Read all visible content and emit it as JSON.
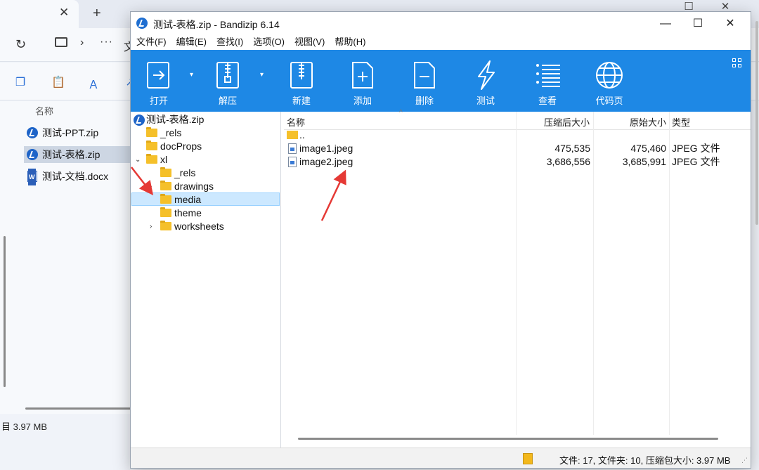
{
  "explorer": {
    "tab_close": "✕",
    "new_tab": "+",
    "more": "···",
    "partial_text": "文",
    "column_name": "名称",
    "files": [
      {
        "name": "测试-PPT.zip",
        "type": "zip"
      },
      {
        "name": "测试-表格.zip",
        "type": "zip",
        "selected": true
      },
      {
        "name": "测试-文档.docx",
        "type": "docx"
      }
    ],
    "status": "目 3.97 MB"
  },
  "bandizip": {
    "title": "测试-表格.zip - Bandizip 6.14",
    "menu": [
      "文件(F)",
      "编辑(E)",
      "查找(I)",
      "选项(O)",
      "视图(V)",
      "帮助(H)"
    ],
    "toolbar": [
      {
        "label": "打开",
        "icon": "open-icon"
      },
      {
        "label": "解压",
        "icon": "extract-icon"
      },
      {
        "label": "新建",
        "icon": "new-archive-icon"
      },
      {
        "label": "添加",
        "icon": "add-file-icon"
      },
      {
        "label": "删除",
        "icon": "delete-file-icon"
      },
      {
        "label": "测试",
        "icon": "test-lightning-icon"
      },
      {
        "label": "查看",
        "icon": "view-list-icon"
      },
      {
        "label": "代码页",
        "icon": "globe-icon"
      }
    ],
    "tree": [
      {
        "label": "测试-表格.zip",
        "kind": "archive"
      },
      {
        "label": "_rels",
        "kind": "folder"
      },
      {
        "label": "docProps",
        "kind": "folder"
      },
      {
        "label": "xl",
        "kind": "folder",
        "expanded": true
      },
      {
        "label": "_rels",
        "kind": "folder"
      },
      {
        "label": "drawings",
        "kind": "folder",
        "collapsed": true
      },
      {
        "label": "media",
        "kind": "folder",
        "selected": true
      },
      {
        "label": "theme",
        "kind": "folder"
      },
      {
        "label": "worksheets",
        "kind": "folder",
        "collapsed": true
      }
    ],
    "columns": {
      "name": "名称",
      "compressed": "压缩后大小",
      "original": "原始大小",
      "type": "类型"
    },
    "rows": [
      {
        "name": "..",
        "compressed": "",
        "original": "",
        "type": ""
      },
      {
        "name": "image1.jpeg",
        "compressed": "475,535",
        "original": "475,460",
        "type": "JPEG 文件"
      },
      {
        "name": "image2.jpeg",
        "compressed": "3,686,556",
        "original": "3,685,991",
        "type": "JPEG 文件"
      }
    ],
    "status": "文件: 17, 文件夹: 10, 压缩包大小: 3.97 MB",
    "colors": {
      "toolbar": "#1e88e5",
      "selection": "#cce8ff",
      "folder": "#f5c02a",
      "annotation_arrow": "#e53935"
    }
  }
}
